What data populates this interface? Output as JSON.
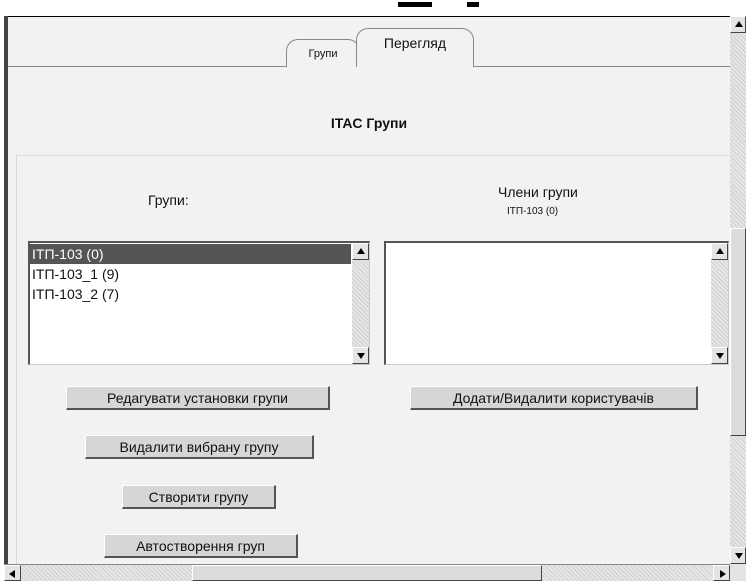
{
  "tabs": [
    {
      "label": "Групи"
    },
    {
      "label": "Перегляд"
    }
  ],
  "page_title": "ITAC Групи",
  "groups": {
    "label": "Групи:",
    "items": [
      {
        "label": "ІТП-103 (0)",
        "selected": true
      },
      {
        "label": "ІТП-103_1 (9)",
        "selected": false
      },
      {
        "label": "ІТП-103_2 (7)",
        "selected": false
      }
    ]
  },
  "members": {
    "label": "Члени групи",
    "sublabel": "ІТП-103 (0)",
    "items": []
  },
  "buttons": {
    "edit": "Редагувати установки групи",
    "delete": "Видалити вибрану групу",
    "create": "Створити групу",
    "auto": "Автостворення груп",
    "add_remove": "Додати/Видалити користувачів"
  },
  "colors": {
    "selected_bg": "#555555",
    "panel_bg": "#f2f2f2"
  }
}
